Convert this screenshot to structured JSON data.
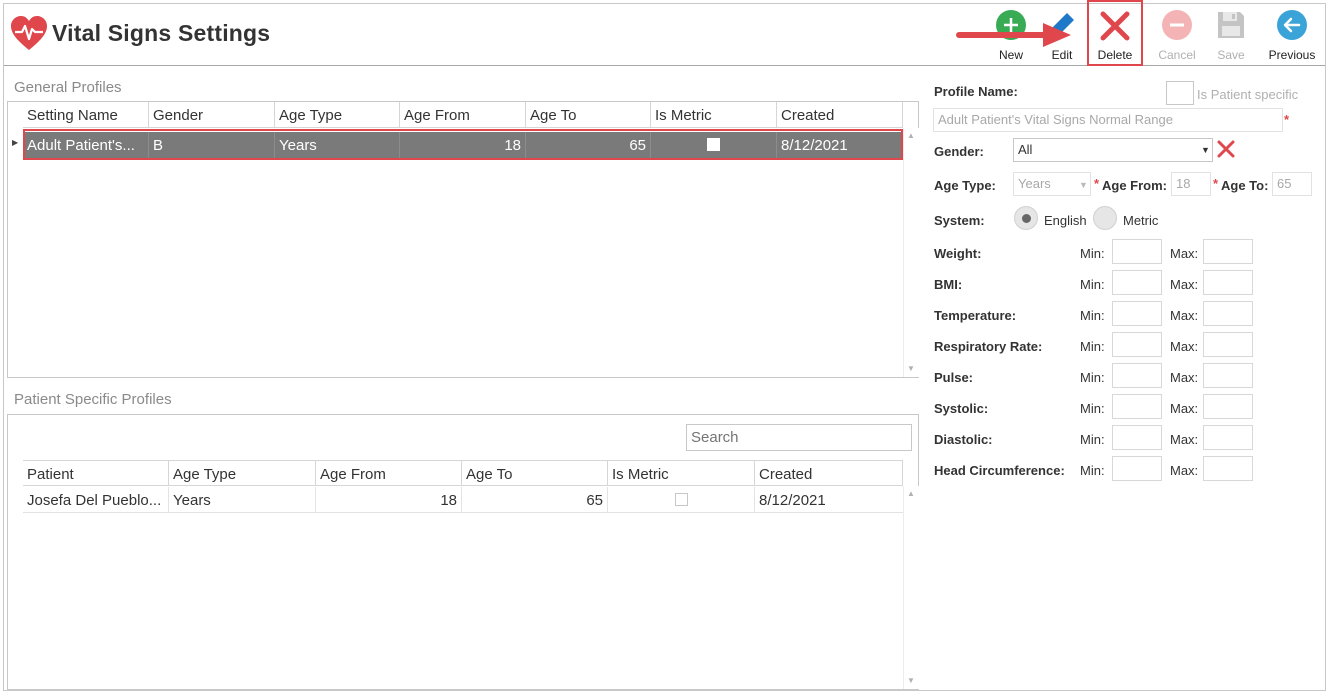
{
  "window": {
    "title": "Vital Signs Settings",
    "icon": "heart-pulse-icon",
    "accent_color": "#e0474c"
  },
  "toolbar": {
    "new": {
      "label": "New",
      "icon": "plus-circle-icon",
      "color": "#3aab55",
      "enabled": true
    },
    "edit": {
      "label": "Edit",
      "icon": "pencil-icon",
      "color": "#1f78c8",
      "enabled": true
    },
    "delete": {
      "label": "Delete",
      "icon": "x-icon",
      "color": "#e0474c",
      "enabled": true
    },
    "cancel": {
      "label": "Cancel",
      "icon": "minus-circle-icon",
      "enabled": false
    },
    "save": {
      "label": "Save",
      "icon": "floppy-disk-icon",
      "enabled": false
    },
    "previous": {
      "label": "Previous",
      "icon": "arrow-left-circle-icon",
      "color": "#3aa3d8",
      "enabled": true
    }
  },
  "general_profiles": {
    "title": "General Profiles",
    "columns": [
      "Setting Name",
      "Gender",
      "Age Type",
      "Age From",
      "Age To",
      "Is Metric",
      "Created"
    ],
    "rows": [
      {
        "setting_name": "Adult Patient's...",
        "gender": "B",
        "age_type": "Years",
        "age_from": "18",
        "age_to": "65",
        "is_metric": false,
        "created": "8/12/2021",
        "selected": true
      }
    ]
  },
  "patient_profiles": {
    "title": "Patient Specific Profiles",
    "search_placeholder": "Search",
    "columns": [
      "Patient",
      "Age Type",
      "Age From",
      "Age To",
      "Is Metric",
      "Created"
    ],
    "rows": [
      {
        "patient": "Josefa Del Pueblo...",
        "age_type": "Years",
        "age_from": "18",
        "age_to": "65",
        "is_metric": false,
        "created": "8/12/2021"
      }
    ]
  },
  "form": {
    "profile_name_label": "Profile Name:",
    "is_patient_specific_label": "Is Patient specific",
    "profile_name_value": "Adult Patient's Vital Signs Normal Range",
    "gender_label": "Gender:",
    "gender_value": "All",
    "age_type_label": "Age Type:",
    "age_type_value": "Years",
    "age_from_label": "Age From:",
    "age_from_value": "18",
    "age_to_label": "Age To:",
    "age_to_value": "65",
    "system_label": "System:",
    "system_options": [
      "English",
      "Metric"
    ],
    "system_selected": "English",
    "min_label": "Min:",
    "max_label": "Max:",
    "vitals": [
      "Weight:",
      "BMI:",
      "Temperature:",
      "Respiratory Rate:",
      "Pulse:",
      "Systolic:",
      "Diastolic:",
      "Head Circumference:"
    ]
  }
}
